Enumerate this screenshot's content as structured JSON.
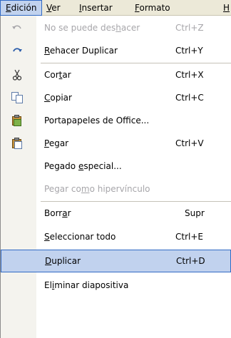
{
  "menubar": [
    {
      "pre": "",
      "u": "E",
      "post": "dición",
      "active": true
    },
    {
      "pre": "",
      "u": "V",
      "post": "er",
      "active": false
    },
    {
      "pre": "",
      "u": "I",
      "post": "nsertar",
      "active": false
    },
    {
      "pre": "",
      "u": "F",
      "post": "ormato",
      "active": false
    },
    {
      "pre": "",
      "u": "H",
      "post": "",
      "active": false
    }
  ],
  "menu": {
    "undo": {
      "pre": "No se puede des",
      "u": "h",
      "post": "acer",
      "shortcut": "Ctrl+Z",
      "icon": "undo-icon"
    },
    "redo": {
      "pre": "",
      "u": "R",
      "post": "ehacer Duplicar",
      "shortcut": "Ctrl+Y",
      "icon": "redo-icon"
    },
    "cut": {
      "pre": "Cor",
      "u": "t",
      "post": "ar",
      "shortcut": "Ctrl+X",
      "icon": "scissors-icon"
    },
    "copy": {
      "pre": "",
      "u": "C",
      "post": "opiar",
      "shortcut": "Ctrl+C",
      "icon": "copy-icon"
    },
    "clipboard": {
      "pre": "Portapapeles de Of",
      "u": "f",
      "post": "ice...",
      "shortcut": "",
      "icon": "office-clipboard-icon"
    },
    "paste": {
      "pre": "",
      "u": "P",
      "post": "egar",
      "shortcut": "Ctrl+V",
      "icon": "paste-icon"
    },
    "paste_special": {
      "pre": "Pegado ",
      "u": "e",
      "post": "special...",
      "shortcut": ""
    },
    "paste_link": {
      "pre": "Pegar co",
      "u": "m",
      "post": "o hipervínculo",
      "shortcut": ""
    },
    "clear": {
      "pre": "Borr",
      "u": "a",
      "post": "r",
      "shortcut": "Supr"
    },
    "select_all": {
      "pre": "",
      "u": "S",
      "post": "eleccionar todo",
      "shortcut": "Ctrl+E"
    },
    "duplicate": {
      "pre": "",
      "u": "D",
      "post": "uplicar",
      "shortcut": "Ctrl+D"
    },
    "delete_slide": {
      "pre": "El",
      "u": "i",
      "post": "minar diapositiva",
      "shortcut": ""
    }
  },
  "colors": {
    "highlight": "#c1d2ee",
    "highlight_border": "#316ac5",
    "disabled": "#a7a6aa"
  }
}
